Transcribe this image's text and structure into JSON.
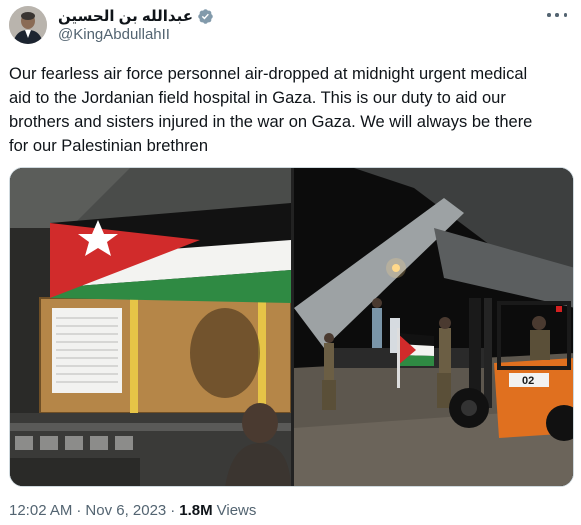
{
  "author": {
    "display_name": "عبدالله بن الحسين",
    "handle": "@KingAbdullahII",
    "verified": true
  },
  "tweet": {
    "text": "Our fearless air force personnel air-dropped at midnight urgent medical\naid to the Jordanian field hospital in Gaza. This is our duty to aid our\nbrothers and sisters injured in the war on Gaza. We will always be there\nfor our Palestinian brethren"
  },
  "media": {
    "photo_count": 2,
    "right_photo_texts": [
      "02"
    ]
  },
  "meta": {
    "time": "12:02 AM",
    "separator": "·",
    "date": "Nov 6, 2023",
    "views_count": "1.8M",
    "views_label": "Views"
  },
  "colors": {
    "text_primary": "#0f1419",
    "text_secondary": "#536471",
    "verified_blue": "#1d9bf0",
    "border": "#cfd9de"
  }
}
